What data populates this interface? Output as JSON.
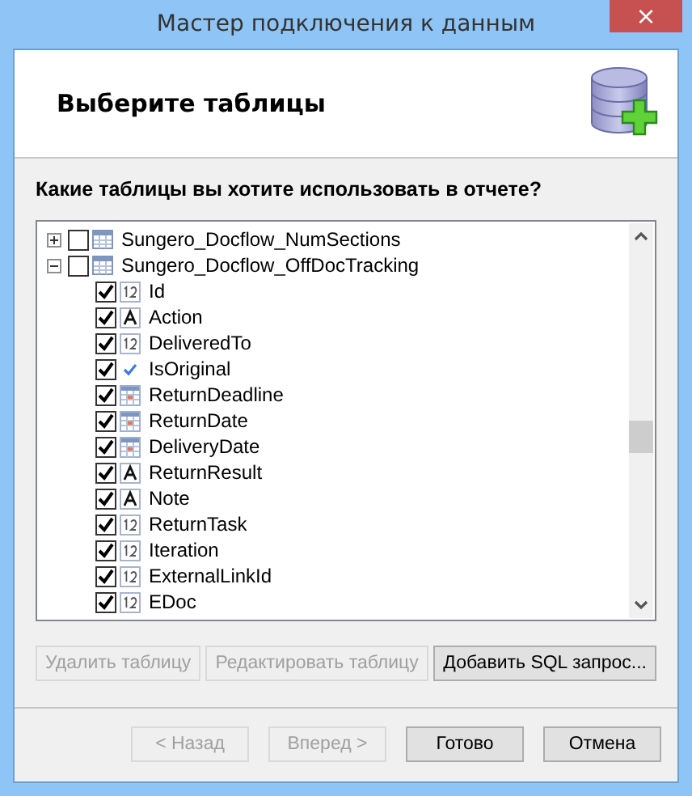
{
  "window": {
    "title": "Мастер подключения к данным",
    "close": "×"
  },
  "header": {
    "title": "Выберите таблицы"
  },
  "question": "Какие таблицы вы хотите использовать в отчете?",
  "tree": [
    {
      "name": "Sungero_Docflow_NumSections",
      "expanded": false,
      "checked": false
    },
    {
      "name": "Sungero_Docflow_OffDocTracking",
      "expanded": true,
      "checked": false,
      "children": [
        {
          "name": "Id",
          "kind": "number",
          "checked": true
        },
        {
          "name": "Action",
          "kind": "text",
          "checked": true
        },
        {
          "name": "DeliveredTo",
          "kind": "number",
          "checked": true
        },
        {
          "name": "IsOriginal",
          "kind": "bool",
          "checked": true
        },
        {
          "name": "ReturnDeadline",
          "kind": "date",
          "checked": true
        },
        {
          "name": "ReturnDate",
          "kind": "date",
          "checked": true
        },
        {
          "name": "DeliveryDate",
          "kind": "date",
          "checked": true
        },
        {
          "name": "ReturnResult",
          "kind": "text",
          "checked": true
        },
        {
          "name": "Note",
          "kind": "text",
          "checked": true
        },
        {
          "name": "ReturnTask",
          "kind": "number",
          "checked": true
        },
        {
          "name": "Iteration",
          "kind": "number",
          "checked": true
        },
        {
          "name": "ExternalLinkId",
          "kind": "number",
          "checked": true
        },
        {
          "name": "EDoc",
          "kind": "number",
          "checked": true
        }
      ]
    }
  ],
  "actions": [
    {
      "label": "Удалить таблицу",
      "disabled": true
    },
    {
      "label": "Редактировать таблицу",
      "disabled": true
    },
    {
      "label": "Добавить SQL запрос...",
      "disabled": false
    }
  ],
  "nav": [
    {
      "label": "< Назад",
      "disabled": true
    },
    {
      "label": "Вперед >",
      "disabled": true
    },
    {
      "label": "Готово",
      "disabled": false
    },
    {
      "label": "Отмена",
      "disabled": false
    }
  ]
}
